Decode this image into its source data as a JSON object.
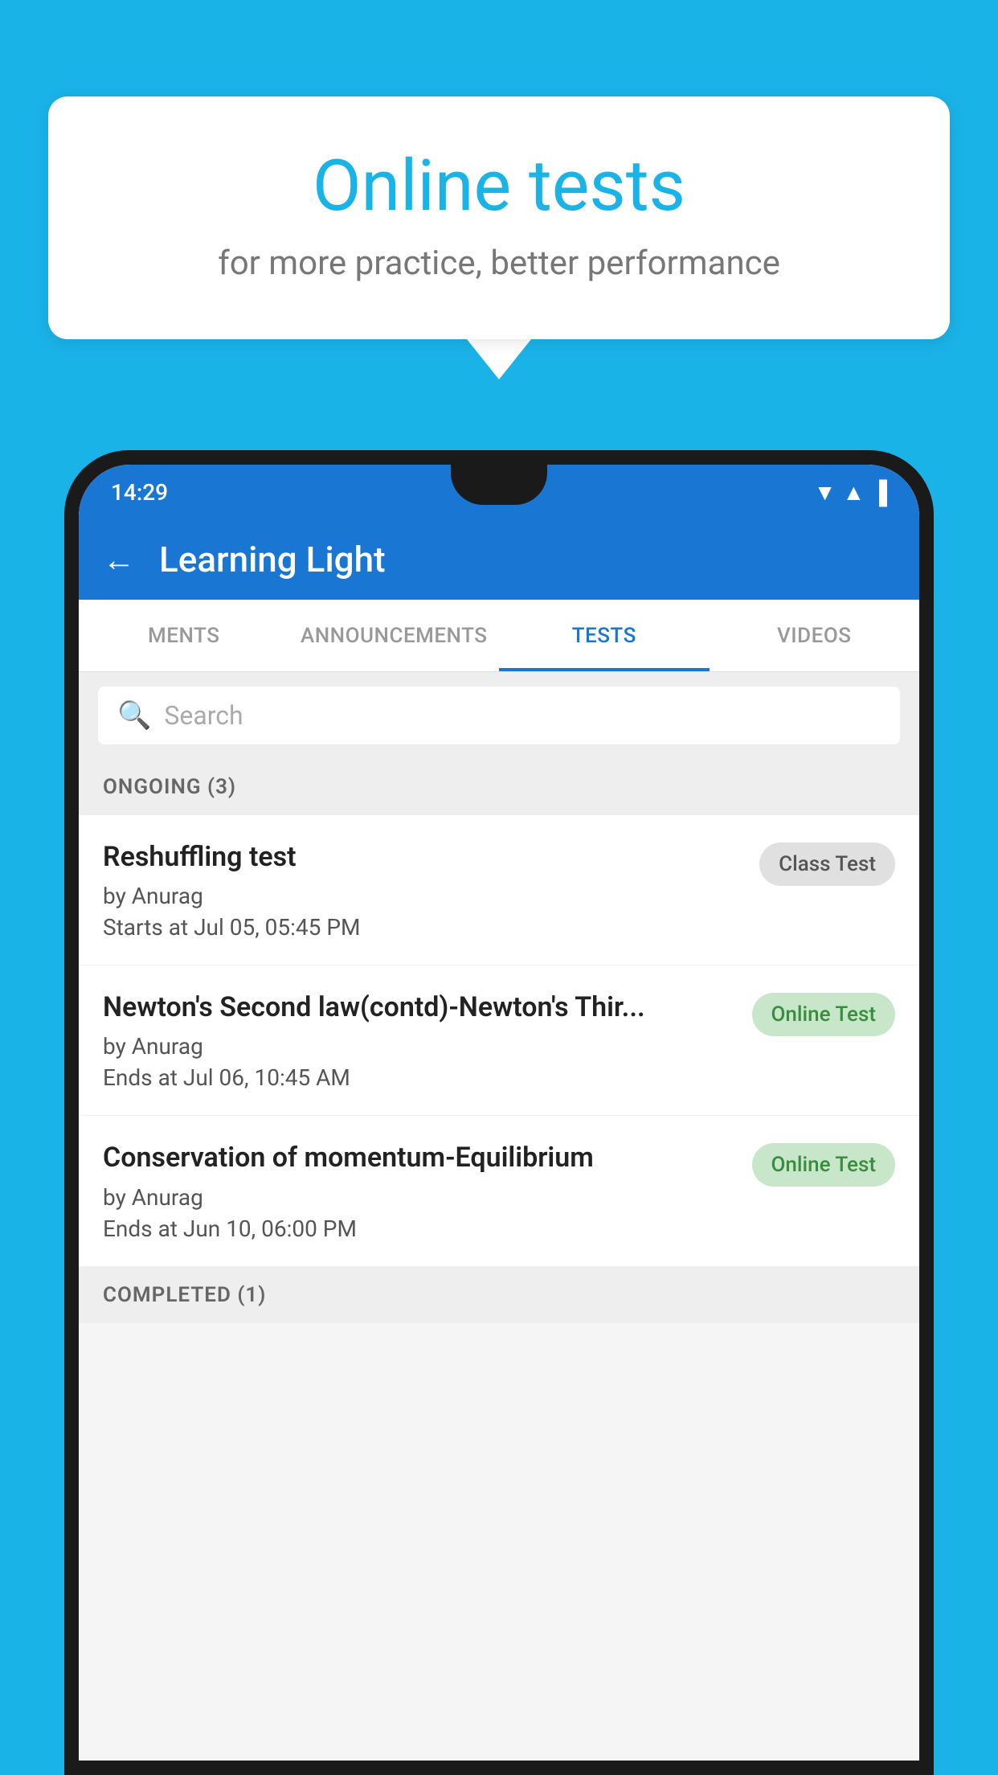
{
  "background_color": "#1ab3e8",
  "speech_bubble": {
    "title": "Online tests",
    "subtitle": "for more practice, better performance"
  },
  "status_bar": {
    "time": "14:29",
    "icons": "▼▲▐"
  },
  "app_bar": {
    "title": "Learning Light",
    "back_label": "←"
  },
  "tabs": [
    {
      "label": "MENTS",
      "active": false
    },
    {
      "label": "ANNOUNCEMENTS",
      "active": false
    },
    {
      "label": "TESTS",
      "active": true
    },
    {
      "label": "VIDEOS",
      "active": false
    }
  ],
  "search": {
    "placeholder": "Search"
  },
  "sections": [
    {
      "header": "ONGOING (3)",
      "items": [
        {
          "title": "Reshuffling test",
          "author": "by Anurag",
          "time": "Starts at  Jul 05, 05:45 PM",
          "badge": "Class Test",
          "badge_type": "class"
        },
        {
          "title": "Newton's Second law(contd)-Newton's Thir...",
          "author": "by Anurag",
          "time": "Ends at  Jul 06, 10:45 AM",
          "badge": "Online Test",
          "badge_type": "online"
        },
        {
          "title": "Conservation of momentum-Equilibrium",
          "author": "by Anurag",
          "time": "Ends at  Jun 10, 06:00 PM",
          "badge": "Online Test",
          "badge_type": "online"
        }
      ]
    }
  ],
  "completed_header": "COMPLETED (1)"
}
